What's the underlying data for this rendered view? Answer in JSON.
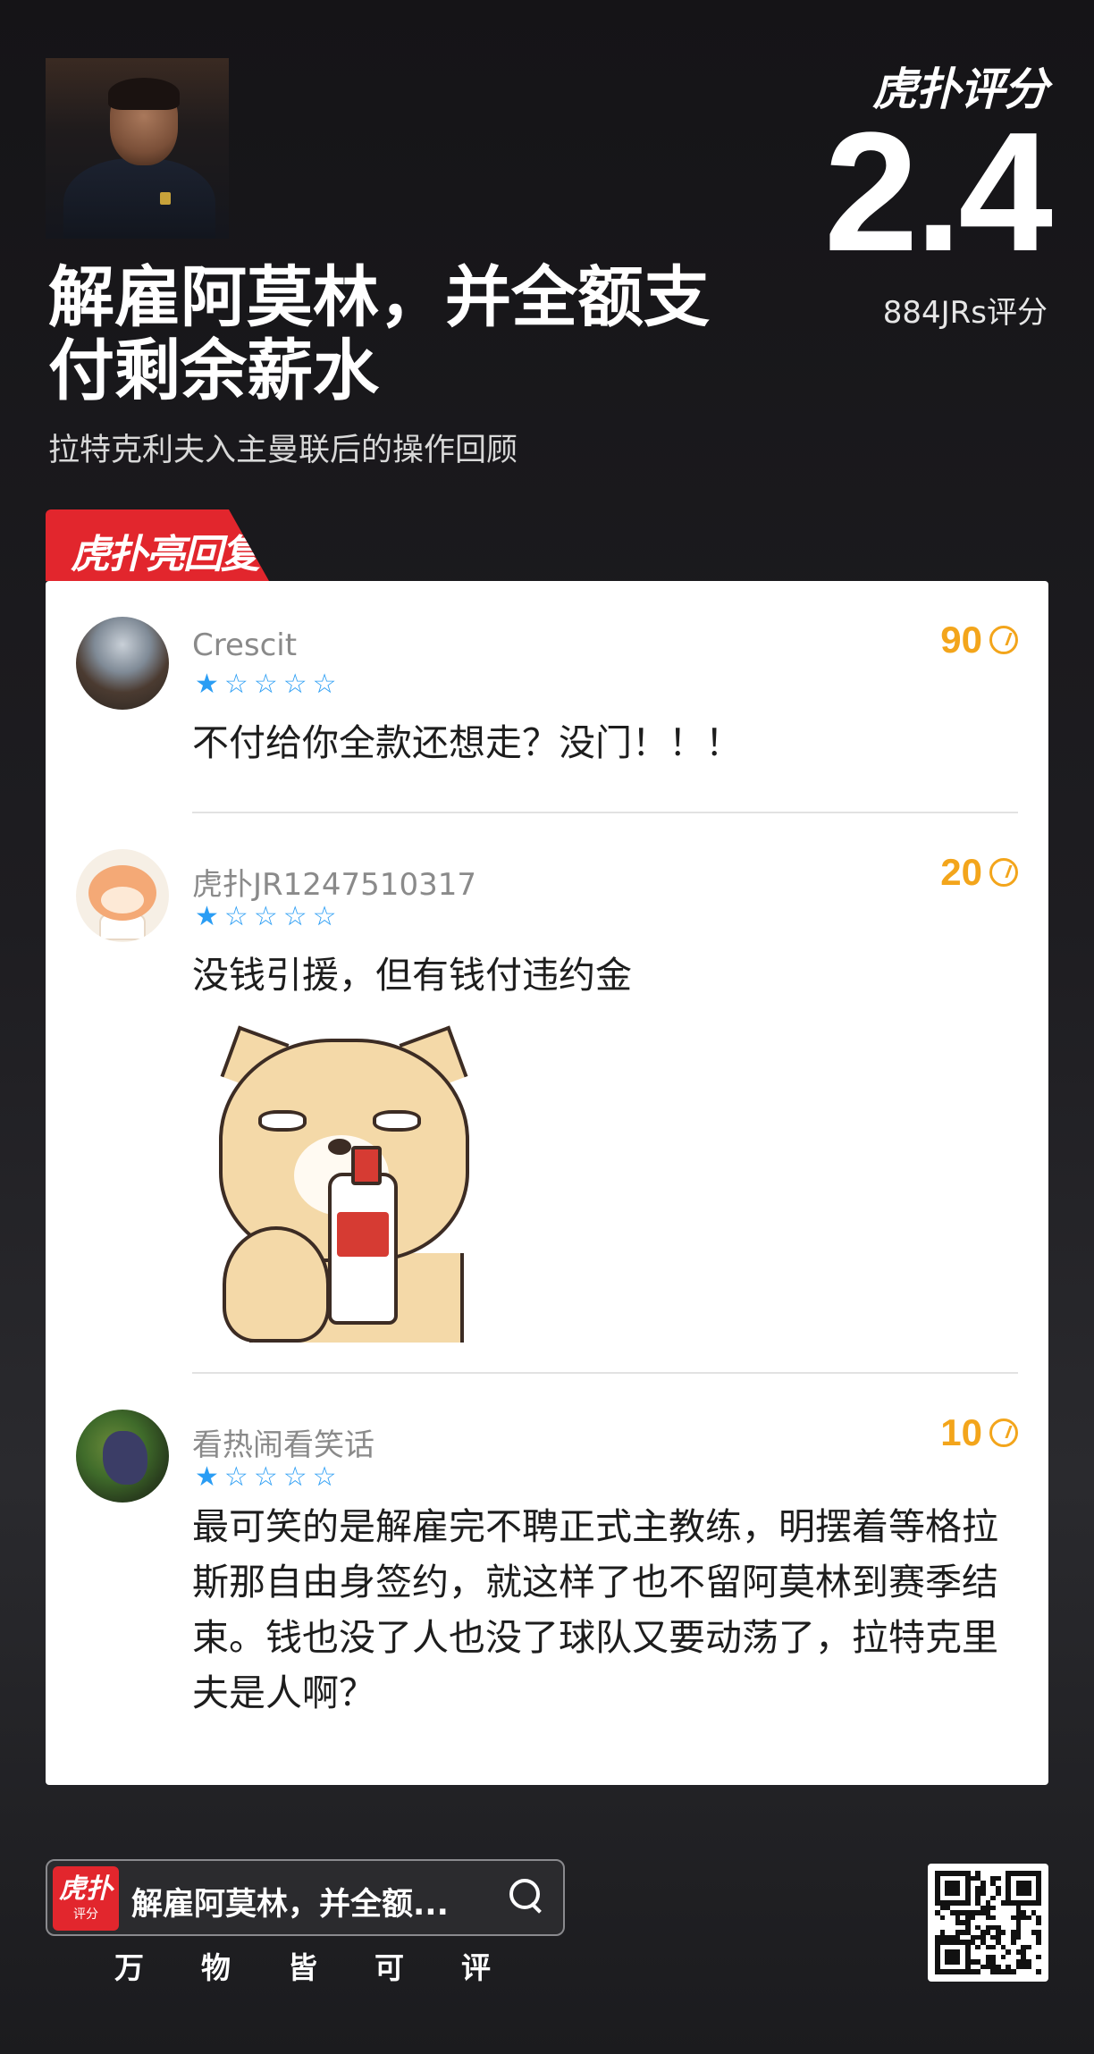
{
  "header": {
    "brand": "虎扑评分",
    "score": "2.4",
    "rating_count": "884JRs评分",
    "title": "解雇阿莫林，并全额支付剩余薪水",
    "subtitle": "拉特克利夫入主曼联后的操作回顾"
  },
  "section": {
    "tab_label": "虎扑亮回复"
  },
  "comments": [
    {
      "username": "Crescit",
      "rating": 1,
      "max_rating": 5,
      "likes": "90",
      "text": "不付给你全款还想走？没门！！！"
    },
    {
      "username": "虎扑JR1247510317",
      "rating": 1,
      "max_rating": 5,
      "likes": "20",
      "text": "没钱引援，但有钱付违约金"
    },
    {
      "username": "看热闹看笑话",
      "rating": 1,
      "max_rating": 5,
      "likes": "10",
      "text": "最可笑的是解雇完不聘正式主教练，明摆着等格拉斯那自由身签约，就这样了也不留阿莫林到赛季结束。钱也没了人也没了球队又要动荡了，拉特克里夫是人啊？"
    }
  ],
  "footer": {
    "logo_text": "虎扑",
    "logo_sub": "评分",
    "search_text": "解雇阿莫林，并全额...",
    "slogan": [
      "万",
      "物",
      "皆",
      "可",
      "评"
    ]
  },
  "colors": {
    "brand_red": "#e2262d",
    "star_blue": "#2a9df4",
    "likes_orange": "#f3a51b"
  },
  "icons": {
    "likes": "lightbulb-icon",
    "search": "search-icon"
  }
}
